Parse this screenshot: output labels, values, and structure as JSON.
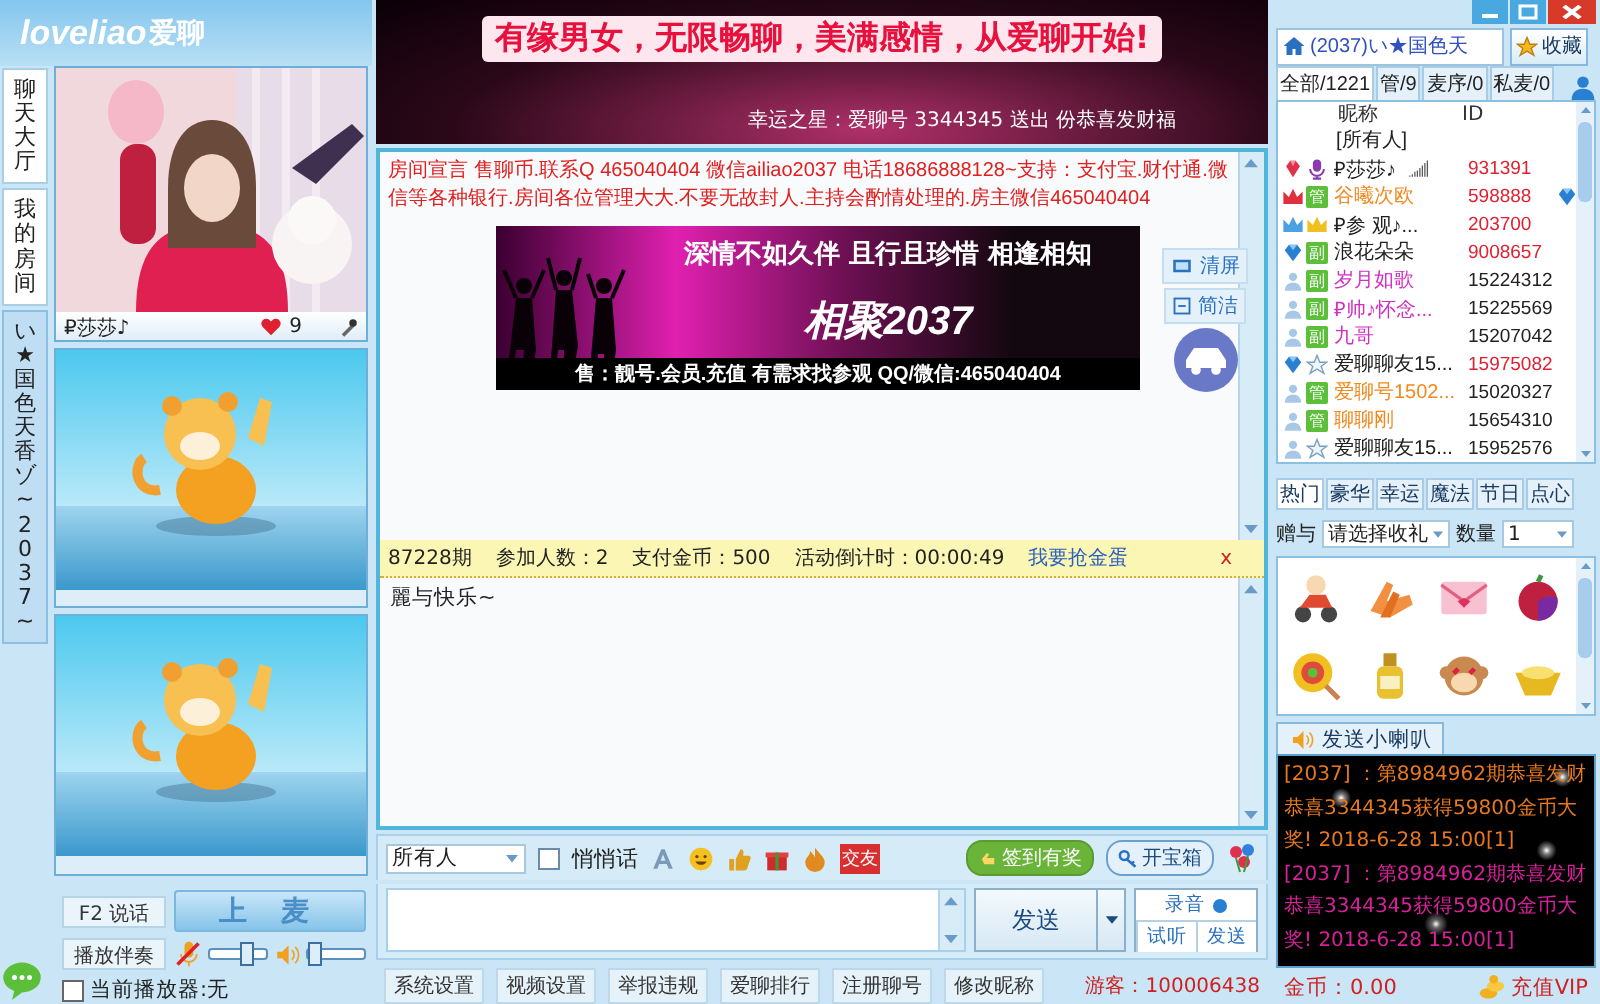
{
  "logo": {
    "text": "loveliao",
    "brand": "爱聊"
  },
  "side_tabs": [
    {
      "label": "聊天大厅",
      "selected": false
    },
    {
      "label": "我的房间",
      "selected": false
    },
    {
      "label": "い★国色天香ゾ~2037~",
      "selected": true
    }
  ],
  "videos": [
    {
      "kind": "camera",
      "name": "₽莎莎♪",
      "likes": "9"
    },
    {
      "kind": "idle"
    },
    {
      "kind": "idle"
    }
  ],
  "mic_controls": {
    "talk_button": "F2 说话",
    "mic_button": "上 麦",
    "accompaniment_button": "播放伴奏",
    "mic_muted": true,
    "mic_slider": {
      "level": 0.65
    },
    "volume_slider": {
      "level": 0.12
    },
    "player_checkbox": {
      "label": "当前播放器:无",
      "checked": false
    }
  },
  "banner": {
    "slogan": "有缘男女，无限畅聊，美满感情，从爱聊开始!",
    "lucky_line": "幸运之星：爱聊号 3344345 送出 份恭喜发财福"
  },
  "announcement": {
    "text": "房间宣言 售聊币.联系Q 465040404 微信ailiao2037 电话18686888128~支持：支付宝.财付通.微信等各种银行.房间各位管理大大.不要无故封人.主持会酌情处理的.房主微信465040404",
    "clear_button": "清屏",
    "simple_button": "简洁",
    "image": {
      "headline": "深情不如久伴 且行且珍惜  相逢相知",
      "title": "相聚2037",
      "footer": "售：靓号.会员.充值 有需求找参观 QQ/微信:465040404"
    }
  },
  "event_bar": {
    "period": "87228期",
    "participants": "参加人数：2",
    "cost": "支付金币：500",
    "countdown": "活动倒计时：00:00:49",
    "link": "我要抢金蛋",
    "close": "x"
  },
  "messages": [
    "麗与快乐~"
  ],
  "composer": {
    "recipient": "所有人",
    "whisper": {
      "label": "悄悄话",
      "checked": false
    },
    "tag": "交友",
    "signin_button": "签到有奖",
    "chest_button": "开宝箱",
    "send_button": "发送",
    "record_button": "录音",
    "listen_button": "试听",
    "voice_send_button": "发送"
  },
  "bottom_menu": [
    "系统设置",
    "视频设置",
    "举报违规",
    "爱聊排行",
    "注册聊号",
    "修改昵称"
  ],
  "status": {
    "guest": "游客：100006438",
    "coins": "金币：0.00",
    "vip": "充值VIP"
  },
  "room": {
    "title": "(2037)い★国色天",
    "favorite_button": "收藏"
  },
  "user_tabs": [
    {
      "label": "全部/1221",
      "selected": true
    },
    {
      "label": "管/9",
      "selected": false
    },
    {
      "label": "麦序/0",
      "selected": false
    },
    {
      "label": "私麦/0",
      "selected": false
    }
  ],
  "user_columns": [
    "昵称",
    "ID"
  ],
  "users": [
    {
      "kind": "everyone",
      "name": "[所有人]"
    },
    {
      "kind": "member",
      "rank": {
        "kind": "ruby"
      },
      "role": {
        "kind": "mic"
      },
      "name": "₽莎莎♪",
      "id": "931391",
      "color": "#202020",
      "vip": true,
      "speaking": true,
      "decorated": false
    },
    {
      "kind": "member",
      "rank": {
        "kind": "crown"
      },
      "role": {
        "kind": "admin",
        "badge": "管"
      },
      "name": "谷曦次欧",
      "id": "598888",
      "color": "#f08a20",
      "vip": true,
      "speaking": false,
      "decorated": true
    },
    {
      "kind": "member",
      "rank": {
        "kind": "crown-blue"
      },
      "role": {
        "kind": "crown"
      },
      "name": "₽参 观♪...",
      "id": "203700",
      "color": "#202020",
      "vip": true,
      "speaking": false,
      "decorated": false
    },
    {
      "kind": "member",
      "rank": {
        "kind": "diamond"
      },
      "role": {
        "kind": "deputy",
        "badge": "副"
      },
      "name": "浪花朵朵",
      "id": "9008657",
      "color": "#202020",
      "vip": true,
      "speaking": false,
      "decorated": false
    },
    {
      "kind": "member",
      "rank": {
        "kind": "person"
      },
      "role": {
        "kind": "deputy",
        "badge": "副"
      },
      "name": "岁月如歌",
      "id": "15224312",
      "color": "#d030c0",
      "vip": false,
      "speaking": false,
      "decorated": false
    },
    {
      "kind": "member",
      "rank": {
        "kind": "person"
      },
      "role": {
        "kind": "deputy",
        "badge": "副"
      },
      "name": "₽帅♪怀念...",
      "id": "15225569",
      "color": "#d030c0",
      "vip": false,
      "speaking": false,
      "decorated": false
    },
    {
      "kind": "member",
      "rank": {
        "kind": "person"
      },
      "role": {
        "kind": "deputy",
        "badge": "副"
      },
      "name": "九哥",
      "id": "15207042",
      "color": "#d030c0",
      "vip": false,
      "speaking": false,
      "decorated": false
    },
    {
      "kind": "member",
      "rank": {
        "kind": "diamond"
      },
      "role": {
        "kind": "star"
      },
      "name": "爱聊聊友15...",
      "id": "15975082",
      "color": "#202020",
      "vip": true,
      "speaking": false,
      "decorated": false
    },
    {
      "kind": "member",
      "rank": {
        "kind": "person"
      },
      "role": {
        "kind": "admin",
        "badge": "管"
      },
      "name": "爱聊号1502...",
      "id": "15020327",
      "color": "#f08a20",
      "vip": false,
      "speaking": false,
      "decorated": false
    },
    {
      "kind": "member",
      "rank": {
        "kind": "person"
      },
      "role": {
        "kind": "admin",
        "badge": "管"
      },
      "name": "聊聊刚",
      "id": "15654310",
      "color": "#f08a20",
      "vip": false,
      "speaking": false,
      "decorated": false
    },
    {
      "kind": "member",
      "rank": {
        "kind": "person"
      },
      "role": {
        "kind": "star"
      },
      "name": "爱聊聊友15...",
      "id": "15952576",
      "color": "#202020",
      "vip": false,
      "speaking": false,
      "decorated": false
    }
  ],
  "gift_tabs": [
    {
      "label": "热门",
      "selected": true
    },
    {
      "label": "豪华",
      "selected": false
    },
    {
      "label": "幸运",
      "selected": false
    },
    {
      "label": "魔法",
      "selected": false
    },
    {
      "label": "节日",
      "selected": false
    },
    {
      "label": "点心",
      "selected": false
    }
  ],
  "gift_picker": {
    "label": "赠与",
    "recipient": "请选择收礼",
    "quantity_label": "数量",
    "quantity": "1"
  },
  "gifts": [
    {
      "kind": "scooter"
    },
    {
      "kind": "hands"
    },
    {
      "kind": "envelope"
    },
    {
      "kind": "fruit"
    },
    {
      "kind": "lollipop"
    },
    {
      "kind": "bottle"
    },
    {
      "kind": "monkey"
    },
    {
      "kind": "ingot"
    }
  ],
  "horn": {
    "tab": "发送小喇叭",
    "messages": [
      {
        "text": "[2037] ：第8984962期恭喜发财恭喜3344345获得59800金币大奖! 2018-6-28 15:00[1]",
        "color": "#e8781e"
      },
      {
        "text": "[2037] ：第8984962期恭喜发财恭喜3344345获得59800金币大奖! 2018-6-28 15:00[1]",
        "color": "#d8209a"
      }
    ]
  }
}
